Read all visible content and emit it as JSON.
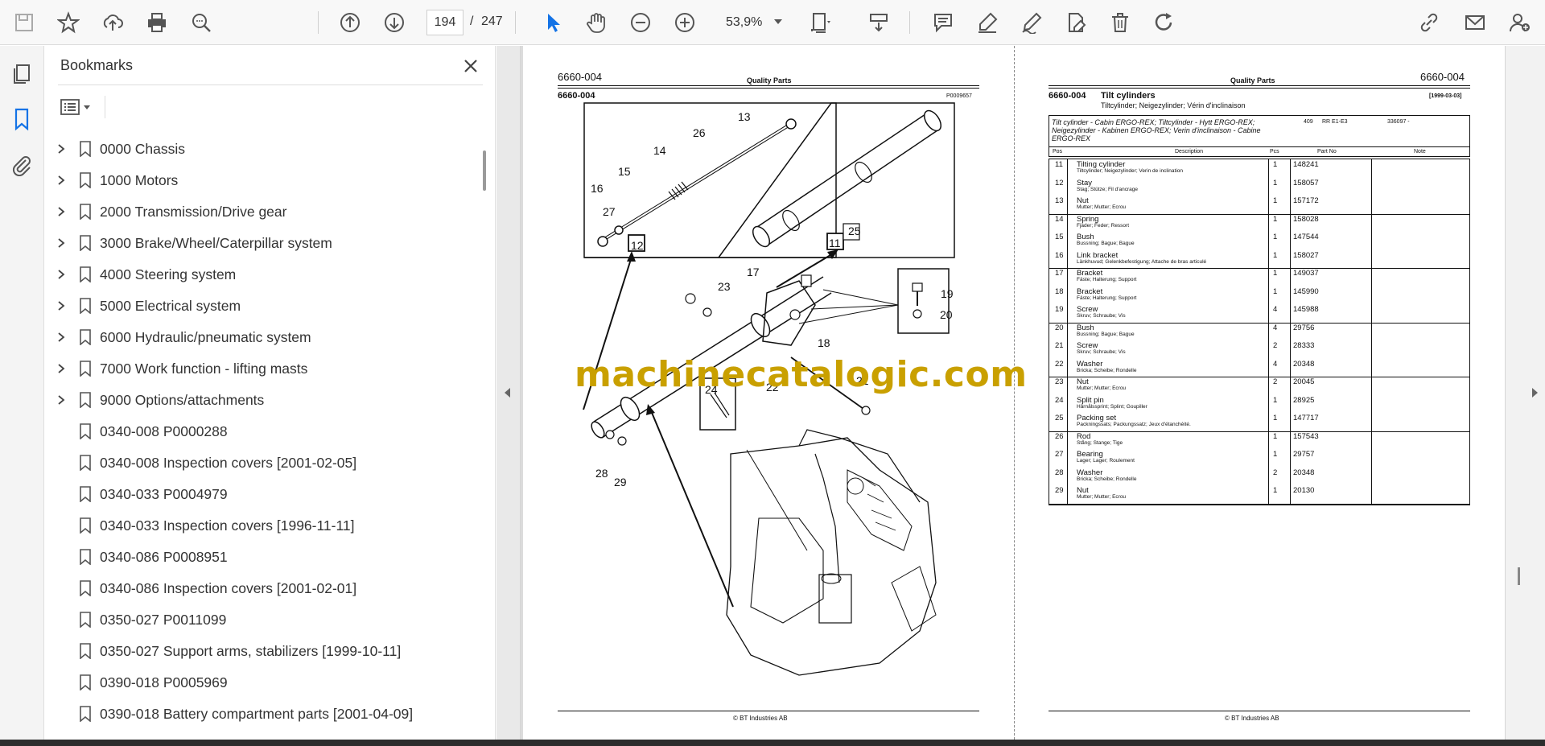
{
  "toolbar": {
    "page_current": "194",
    "page_separator": "/",
    "page_total": "247",
    "zoom": "53,9%"
  },
  "bookmarks": {
    "title": "Bookmarks",
    "items": [
      {
        "label": "0000 Chassis",
        "expandable": true
      },
      {
        "label": "1000 Motors",
        "expandable": true
      },
      {
        "label": "2000 Transmission/Drive gear",
        "expandable": true
      },
      {
        "label": "3000 Brake/Wheel/Caterpillar system",
        "expandable": true
      },
      {
        "label": "4000 Steering system",
        "expandable": true
      },
      {
        "label": "5000 Electrical system",
        "expandable": true
      },
      {
        "label": "6000 Hydraulic/pneumatic system",
        "expandable": true
      },
      {
        "label": "7000 Work function - lifting masts",
        "expandable": true
      },
      {
        "label": "9000 Options/attachments",
        "expandable": true
      },
      {
        "label": "0340-008 P0000288",
        "expandable": false
      },
      {
        "label": "0340-008 Inspection covers [2001-02-05]",
        "expandable": false
      },
      {
        "label": "0340-033 P0004979",
        "expandable": false
      },
      {
        "label": "0340-033 Inspection covers [1996-11-11]",
        "expandable": false
      },
      {
        "label": "0340-086 P0008951",
        "expandable": false
      },
      {
        "label": "0340-086 Inspection covers [2001-02-01]",
        "expandable": false
      },
      {
        "label": "0350-027 P0011099",
        "expandable": false
      },
      {
        "label": "0350-027 Support arms, stabilizers [1999-10-11]",
        "expandable": false
      },
      {
        "label": "0390-018 P0005969",
        "expandable": false
      },
      {
        "label": "0390-018 Battery compartment parts [2001-04-09]",
        "expandable": false
      }
    ]
  },
  "left_page": {
    "code": "6660-004",
    "header_center": "Quality Parts",
    "sub_code": "6660-004",
    "drawing_no": "P0009657",
    "callouts": [
      "13",
      "26",
      "14",
      "15",
      "16",
      "27",
      "12",
      "11",
      "25",
      "17",
      "23",
      "19",
      "20",
      "18",
      "21",
      "24",
      "22",
      "28",
      "29"
    ],
    "footer": "© BT Industries AB"
  },
  "right_page": {
    "header_center": "Quality Parts",
    "code": "6660-004",
    "sub_code": "6660-004",
    "title": "Tilt cylinders",
    "subtitle": "Tiltcylinder; Neigezylinder; Vérin d'inclinaison",
    "date": "[1999-03-03]",
    "desc_line1": "Tilt cylinder - Cabin  ERGO-REX; Tiltcylinder - Hytt  ERGO-REX;",
    "desc_line2": "Neigezylinder - Kabinen  ERGO-REX; Verin d'inclinaison - Cabine",
    "desc_line3": "ERGO-REX",
    "model_a": "409",
    "model_b": "RR E1-E3",
    "model_c": "336097 -",
    "columns": {
      "pos": "Pos",
      "description": "Description",
      "pcs": "Pcs",
      "part_no": "Part No",
      "note": "Note"
    },
    "rows": [
      {
        "pos": "11",
        "desc": "Tilting cylinder",
        "sub": "Tiltcylinder; Neigezylinder; Verin de inclination",
        "pcs": "1",
        "part": "148241"
      },
      {
        "pos": "12",
        "desc": "Stay",
        "sub": "Stag; Stütze; Fil d'ancrage",
        "pcs": "1",
        "part": "158057"
      },
      {
        "pos": "13",
        "desc": "Nut",
        "sub": "Mutter; Mutter; Ecrou",
        "pcs": "1",
        "part": "157172"
      },
      {
        "pos": "14",
        "desc": "Spring",
        "sub": "Fjäder; Feder; Ressort",
        "pcs": "1",
        "part": "158028"
      },
      {
        "pos": "15",
        "desc": "Bush",
        "sub": "Bussning; Bague; Bague",
        "pcs": "1",
        "part": "147544"
      },
      {
        "pos": "16",
        "desc": "Link bracket",
        "sub": "Länkhuvud; Gelenkbefestigung; Attache de bras articulé",
        "pcs": "1",
        "part": "158027"
      },
      {
        "pos": "17",
        "desc": "Bracket",
        "sub": "Fäste; Halterung; Support",
        "pcs": "1",
        "part": "149037"
      },
      {
        "pos": "18",
        "desc": "Bracket",
        "sub": "Fäste; Halterung; Support",
        "pcs": "1",
        "part": "145990"
      },
      {
        "pos": "19",
        "desc": "Screw",
        "sub": "Skruv; Schraube; Vis",
        "pcs": "4",
        "part": "145988"
      },
      {
        "pos": "20",
        "desc": "Bush",
        "sub": "Bussning; Bague; Bague",
        "pcs": "4",
        "part": "29756"
      },
      {
        "pos": "21",
        "desc": "Screw",
        "sub": "Skruv; Schraube; Vis",
        "pcs": "2",
        "part": "28333"
      },
      {
        "pos": "22",
        "desc": "Washer",
        "sub": "Bricka; Scheibe; Rondelle",
        "pcs": "4",
        "part": "20348"
      },
      {
        "pos": "23",
        "desc": "Nut",
        "sub": "Mutter; Mutter; Ecrou",
        "pcs": "2",
        "part": "20045"
      },
      {
        "pos": "24",
        "desc": "Split pin",
        "sub": "Hårnålssprint; Splint; Goupiller",
        "pcs": "1",
        "part": "28925"
      },
      {
        "pos": "25",
        "desc": "Packing set",
        "sub": "Packningssats; Packungssatz; Jeux d'étanchéité.",
        "pcs": "1",
        "part": "147717"
      },
      {
        "pos": "26",
        "desc": "Rod",
        "sub": "Stång; Stange; Tige",
        "pcs": "1",
        "part": "157543"
      },
      {
        "pos": "27",
        "desc": "Bearing",
        "sub": "Lager; Lager; Roulement",
        "pcs": "1",
        "part": "29757"
      },
      {
        "pos": "28",
        "desc": "Washer",
        "sub": "Bricka; Scheibe; Rondelle",
        "pcs": "2",
        "part": "20348"
      },
      {
        "pos": "29",
        "desc": "Nut",
        "sub": "Mutter; Mutter; Ecrou",
        "pcs": "1",
        "part": "20130"
      }
    ],
    "footer": "© BT Industries AB"
  },
  "watermark": "machinecatalogic.com",
  "colors": {
    "accent": "#1473e6",
    "watermark": "#c9a000"
  }
}
